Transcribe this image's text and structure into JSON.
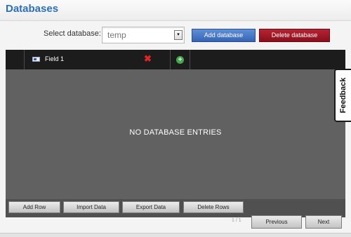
{
  "header": {
    "title": "Databases"
  },
  "database_selector": {
    "label": "Select database:",
    "selected": "temp",
    "arrow_glyph": "▾"
  },
  "actions": {
    "add_database": "Add database",
    "delete_database": "Delete database"
  },
  "table": {
    "columns": [
      {
        "label": "Field 1"
      }
    ],
    "remove_glyph": "✖",
    "add_glyph": "+",
    "empty_message": "NO DATABASE ENTRIES"
  },
  "table_actions": {
    "add_row": "Add Row",
    "import_data": "Import Data",
    "export_data": "Export Data",
    "delete_rows": "Delete Rows"
  },
  "pagination": {
    "info": "1 / 1",
    "previous": "Previous",
    "next": "Next"
  },
  "feedback": {
    "label": "Feedback"
  },
  "colors": {
    "title": "#2b70b8",
    "add_database_bg": "#3664b6",
    "delete_database_bg": "#8a0f1c",
    "table_bg": "#616161",
    "header_bg": "#1c1c1c"
  },
  "icons": {
    "field": "field-type-icon",
    "remove": "remove-field-icon",
    "add": "add-field-icon"
  }
}
